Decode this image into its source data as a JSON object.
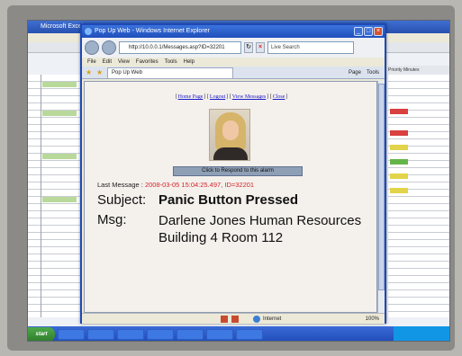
{
  "background_window": {
    "title": "Microsoft Excel",
    "column_headers": [
      "Priority",
      "Minutes"
    ],
    "tags": [
      "#d94040",
      "#d94040",
      "#e2d44a",
      "#63b54a",
      "#e2d44a",
      "#e2d44a"
    ]
  },
  "browser": {
    "title": "Pop Up Web - Windows Internet Explorer",
    "address": "http://10.0.0.1/Messages.asp?ID=32201",
    "search_placeholder": "Live Search",
    "menu": [
      "File",
      "Edit",
      "View",
      "Favorites",
      "Tools",
      "Help"
    ],
    "tab_label": "Pop Up Web",
    "commands": [
      "Page",
      "Tools"
    ],
    "zoom": "100%",
    "zone": "Internet"
  },
  "page": {
    "links": [
      "Home Page",
      "Logout",
      "View Messages",
      "Close"
    ],
    "respond_button": "Click to Respond to this alarm",
    "last_message_label": "Last Message :",
    "last_message_stamp": "2008-03-05 15:04:25.497, ID=32201",
    "subject_label": "Subject:",
    "subject_value": "Panic Button Pressed",
    "msg_label": "Msg:",
    "msg_value": "Darlene Jones Human Resources Building 4 Room 112"
  },
  "taskbar": {
    "start_label": "start"
  }
}
